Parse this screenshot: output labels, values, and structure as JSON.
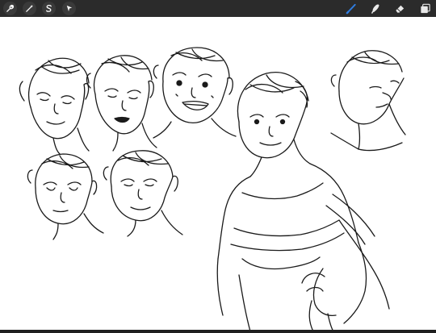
{
  "toolbar": {
    "left_actions": [
      {
        "name": "actions",
        "icon": "wrench-icon"
      },
      {
        "name": "adjustments",
        "icon": "magic-wand-icon"
      },
      {
        "name": "selection",
        "icon": "selection-s-icon"
      },
      {
        "name": "transform",
        "icon": "arrow-cursor-icon"
      }
    ],
    "right_tools": [
      {
        "name": "brush",
        "icon": "brush-icon",
        "active": true
      },
      {
        "name": "smudge",
        "icon": "smudge-icon",
        "active": false
      },
      {
        "name": "eraser",
        "icon": "eraser-icon",
        "active": false
      },
      {
        "name": "layers",
        "icon": "layers-icon",
        "active": false
      }
    ],
    "colors": {
      "bar": "#2b2b2b",
      "active_tool": "#2f7de1",
      "icon": "#ffffff"
    }
  },
  "canvas": {
    "content": "sketch-drawing",
    "colors": {
      "background": "#ffffff",
      "ink": "#1a1a1a"
    }
  }
}
